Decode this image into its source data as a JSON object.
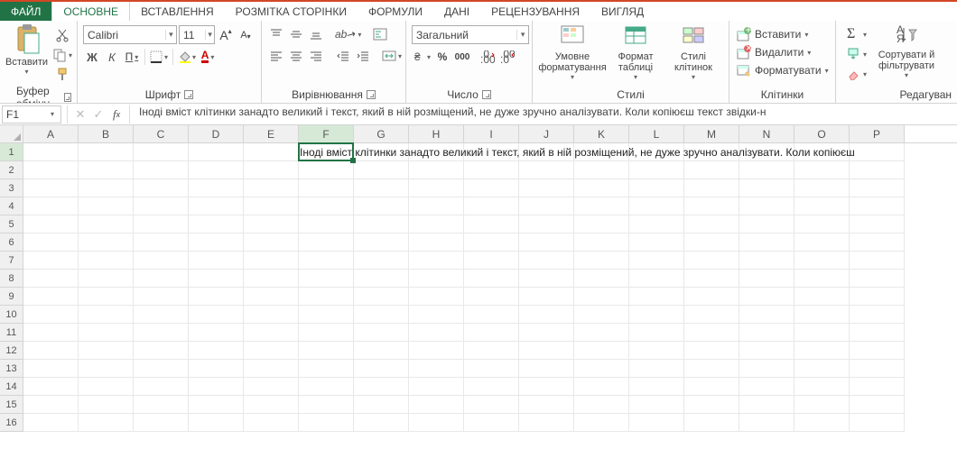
{
  "tabs": {
    "file": "ФАЙЛ",
    "home": "ОСНОВНЕ",
    "insert": "ВСТАВЛЕННЯ",
    "layout": "РОЗМІТКА СТОРІНКИ",
    "formulas": "ФОРМУЛИ",
    "data": "ДАНІ",
    "review": "РЕЦЕНЗУВАННЯ",
    "view": "ВИГЛЯД"
  },
  "ribbon": {
    "clipboard": {
      "paste": "Вставити",
      "group": "Буфер обміну"
    },
    "font": {
      "name": "Calibri",
      "size": "11",
      "bold": "Ж",
      "italic": "К",
      "underline": "П",
      "group": "Шрифт"
    },
    "align": {
      "group": "Вирівнювання"
    },
    "number": {
      "format": "Загальний",
      "group": "Число"
    },
    "styles": {
      "cond": "Умовне форматування",
      "table": "Формат таблиці",
      "cell": "Стилі клітинок",
      "group": "Стилі"
    },
    "cells": {
      "insert": "Вставити",
      "delete": "Видалити",
      "format": "Форматувати",
      "group": "Клітинки"
    },
    "editing": {
      "sort": "Сортувати й фільтрувати",
      "group": "Редагуван"
    }
  },
  "namebox": "F1",
  "formula": "Іноді вміст клітинки занадто великий і текст, який в ній розміщений, не дуже зручно аналізувати. Коли копіюєш текст звідки-н",
  "columns": [
    "A",
    "B",
    "C",
    "D",
    "E",
    "F",
    "G",
    "H",
    "I",
    "J",
    "K",
    "L",
    "M",
    "N",
    "O",
    "P"
  ],
  "active_col": "F",
  "active_row": 1,
  "rowcount": 16,
  "celltext": "Іноді вміст клітинки занадто великий і текст, який в ній розміщений, не дуже зручно аналізувати. Коли копіюєш "
}
